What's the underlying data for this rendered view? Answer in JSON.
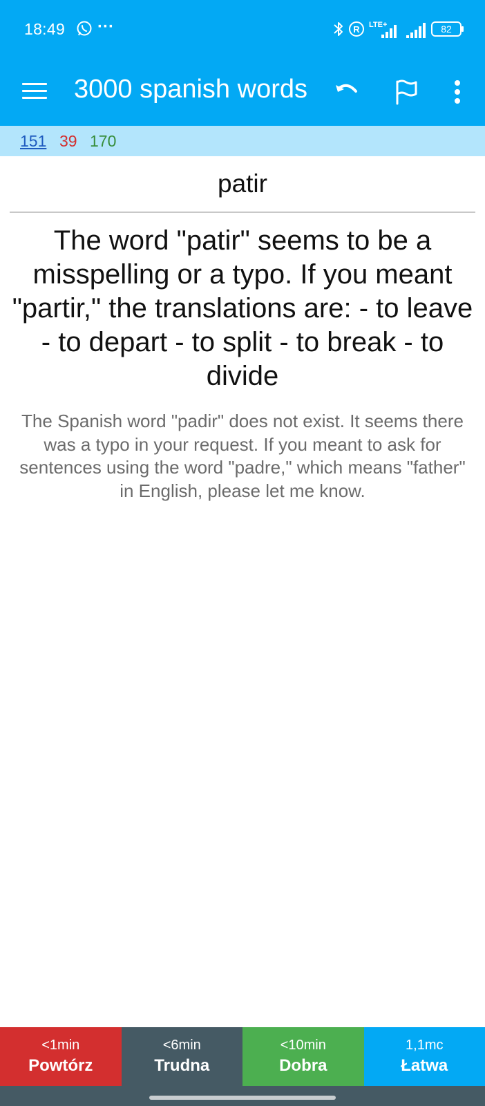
{
  "status_bar": {
    "time": "18:49",
    "dots": "···",
    "network_label": "LTE+",
    "battery": "82"
  },
  "app_bar": {
    "title": "3000 spanish words",
    "icons": [
      "menu-icon",
      "undo-icon",
      "flag-icon",
      "more-vert-icon"
    ]
  },
  "counts": {
    "new": "151",
    "learning": "39",
    "review": "170"
  },
  "card": {
    "word": "patir",
    "translation": "The word \"patir\" seems to be a misspelling or a typo. If you meant \"partir,\" the translations are: - to leave - to depart - to split - to break - to divide",
    "example": "The Spanish word \"padir\" does not exist. It seems there was a typo in your request. If you meant to ask for sentences using the word \"padre,\" which means \"father\" in English, please let me know."
  },
  "answer_buttons": [
    {
      "time": "<1min",
      "label": "Powtórz",
      "color": "#d32f2f"
    },
    {
      "time": "<6min",
      "label": "Trudna",
      "color": "#455a64"
    },
    {
      "time": "<10min",
      "label": "Dobra",
      "color": "#4caf50"
    },
    {
      "time": "1,1mc",
      "label": "Łatwa",
      "color": "#03a9f4"
    }
  ],
  "colors": {
    "primary": "#03a9f4",
    "counts_background": "#b3e5fc",
    "count_new": "#1e5bbf",
    "count_learning": "#d32f2f",
    "count_review": "#388e3c",
    "navbar": "#455a64"
  }
}
